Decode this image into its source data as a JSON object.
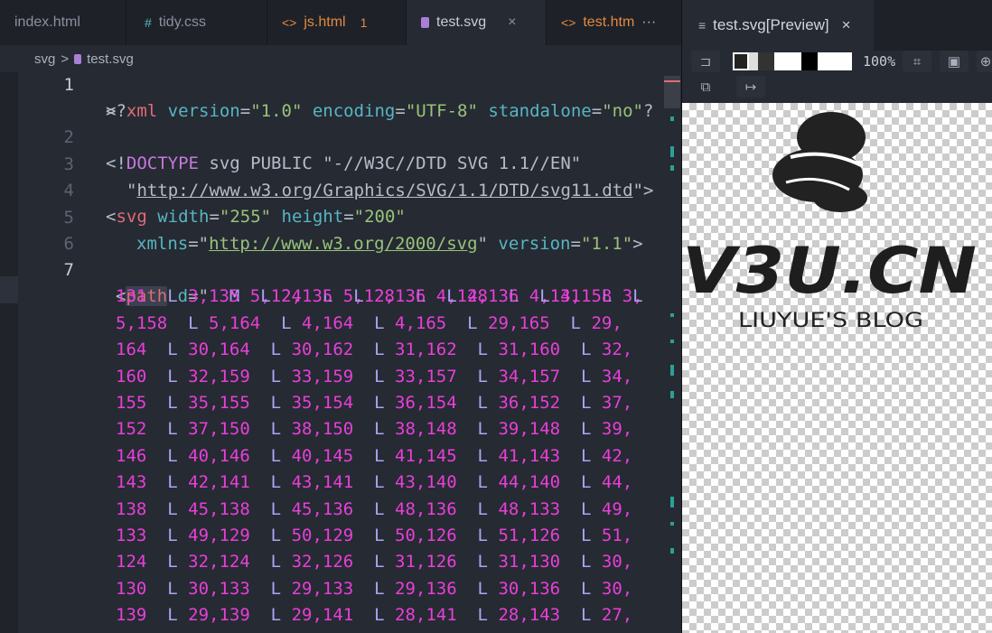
{
  "tabs": [
    {
      "label": "index.html",
      "icon": ""
    },
    {
      "label": "tidy.css",
      "icon": "#"
    },
    {
      "label": "js.html",
      "icon": "<>",
      "badge": "1"
    },
    {
      "label": "test.svg",
      "icon": "svg-file",
      "close": "×"
    },
    {
      "label": "test.htm",
      "icon": "<>",
      "more": "···"
    }
  ],
  "breadcrumb": {
    "folder": "svg",
    "sep": ">",
    "file": "test.svg"
  },
  "editor": {
    "line_numbers": [
      "1",
      "",
      "2",
      "3",
      "4",
      "5",
      "6",
      "7"
    ],
    "path_rows": [
      "M 5,124  L 5,128  L 4,128  L 4,131  L 3,",
      "131  L 3,135  L 2,135  L 2,136  L 4,136  L 4,158  L",
      "5,158  L 5,164  L 4,164  L 4,165  L 29,165  L 29,",
      "164  L 30,164  L 30,162  L 31,162  L 31,160  L 32,",
      "160  L 32,159  L 33,159  L 33,157  L 34,157  L 34,",
      "155  L 35,155  L 35,154  L 36,154  L 36,152  L 37,",
      "152  L 37,150  L 38,150  L 38,148  L 39,148  L 39,",
      "146  L 40,146  L 40,145  L 41,145  L 41,143  L 42,",
      "143  L 42,141  L 43,141  L 43,140  L 44,140  L 44,",
      "138  L 45,138  L 45,136  L 48,136  L 48,133  L 49,",
      "133  L 49,129  L 50,129  L 50,126  L 51,126  L 51,",
      "124  L 32,124  L 32,126  L 31,126  L 31,130  L 30,",
      "130  L 30,133  L 29,133  L 29,136  L 30,136  L 30,",
      "139  L 29,139  L 29,141  L 28,141  L 28,143  L 27,"
    ],
    "t": {
      "xml": "xml",
      "version": "version",
      "v10": "\"1.0\"",
      "encoding": "encoding",
      "utf8": "\"UTF-8\"",
      "standalone": "standalone",
      "no": "\"no\"",
      "doctype": "DOCTYPE",
      "public": " svg PUBLIC \"-//W3C//DTD SVG 1.1//EN\"",
      "dtd": "http://www.w3.org/Graphics/SVG/1.1/DTD/svg11.dtd",
      "svg": "svg",
      "width": "width",
      "w255": "\"255\"",
      "height": "height",
      "h200": "\"200\"",
      "xmlns": "xmlns",
      "ns": "http://www.w3.org/2000/svg",
      "v11": "\"1.1\"",
      "path": "path",
      "d": "d"
    }
  },
  "preview": {
    "tab_label": "test.svg[Preview]",
    "close": "×",
    "zoom": "100%",
    "logo_text": "V3U.CN",
    "logo_sub": "LIUYUE'S BLOG"
  }
}
